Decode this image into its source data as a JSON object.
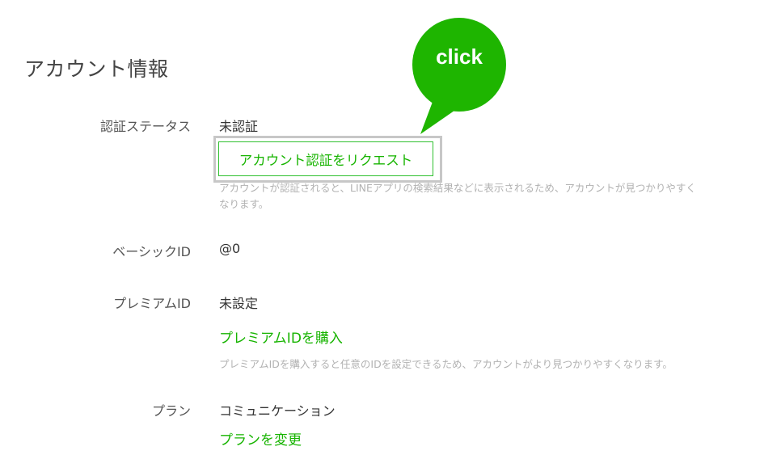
{
  "section_title": "アカウント情報",
  "callout": {
    "text": "click",
    "color": "#1eb500"
  },
  "verification": {
    "label": "認証ステータス",
    "value": "未認証",
    "button_label": "アカウント認証をリクエスト",
    "help_line1": "アカウントが認証されると、LINEアプリの検索結果などに表示されるため、アカウントが見つかりやすく",
    "help_line2": "なります。"
  },
  "basic_id": {
    "label": "ベーシックID",
    "value": "@0"
  },
  "premium_id": {
    "label": "プレミアムID",
    "value": "未設定",
    "link_label": "プレミアムIDを購入",
    "help": "プレミアムIDを購入すると任意のIDを設定できるため、アカウントがより見つかりやすくなります。"
  },
  "plan": {
    "label": "プラン",
    "value": "コミュニケーション",
    "link_label": "プランを変更"
  },
  "colors": {
    "accent_green": "#17b400",
    "highlight_border": "#c7c7c7",
    "help_text": "#b2b2b2"
  }
}
